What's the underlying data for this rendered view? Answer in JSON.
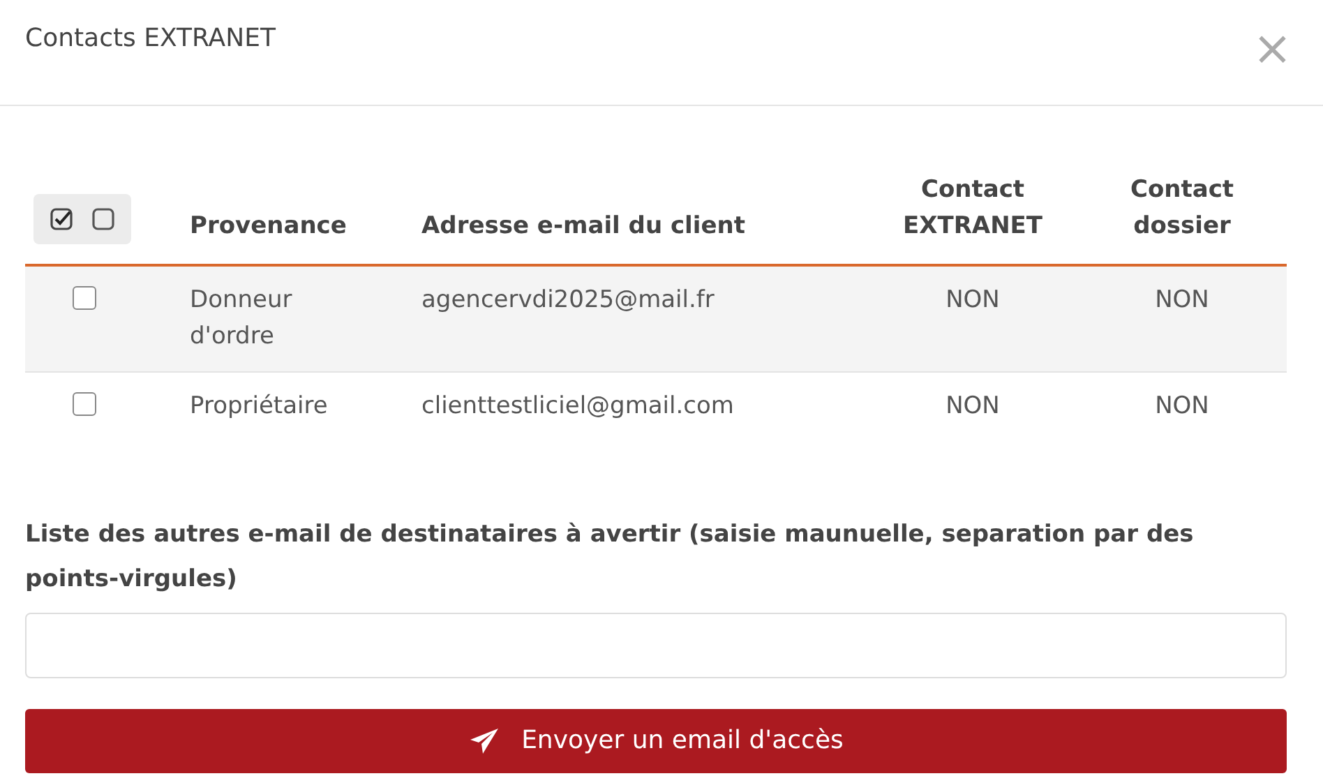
{
  "dialog": {
    "title": "Contacts EXTRANET",
    "close": "×"
  },
  "table": {
    "columns": [
      "Provenance",
      "Adresse e-mail du client",
      "Contact EXTRANET",
      "Contact dossier"
    ],
    "rows": [
      {
        "checked": false,
        "cells": [
          "Donneur d'ordre",
          "agencervdi2025@mail.fr",
          "NON",
          "NON"
        ]
      },
      {
        "checked": false,
        "cells": [
          "Propriétaire",
          "clienttestliciel@gmail.com",
          "NON",
          "NON"
        ]
      }
    ]
  },
  "other_emails": {
    "label": "Liste des autres e-mail de destinataires à avertir (saisie maunuelle, separation par des points-virgules)"
  },
  "send_button": {
    "label": "Envoyer un email d'accès"
  }
}
